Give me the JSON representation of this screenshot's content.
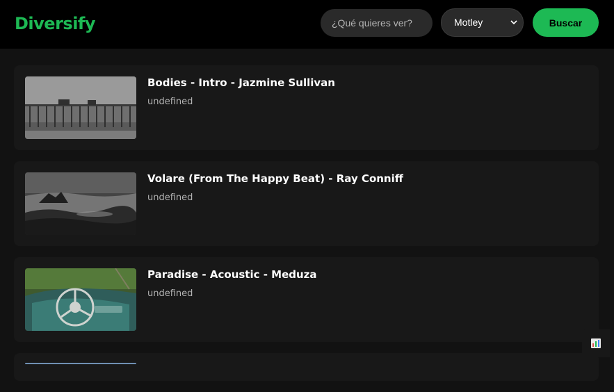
{
  "header": {
    "logo": "Diversify",
    "search": {
      "placeholder": "¿Qué quieres ver?",
      "value": ""
    },
    "type_select": {
      "selected": "Motley"
    },
    "search_button": "Buscar"
  },
  "results": [
    {
      "title": "Bodies - Intro - Jazmine Sullivan",
      "subtitle": "undefined",
      "thumb": "pier-image"
    },
    {
      "title": "Volare (From The Happy Beat) - Ray Conniff",
      "subtitle": "undefined",
      "thumb": "rocky-coast-image"
    },
    {
      "title": "Paradise - Acoustic - Meduza",
      "subtitle": "undefined",
      "thumb": "steering-wheel-image"
    }
  ],
  "icons": {
    "stats": "bar-chart-icon"
  },
  "colors": {
    "accent": "#1db954",
    "background": "#121212",
    "card": "#181818"
  }
}
